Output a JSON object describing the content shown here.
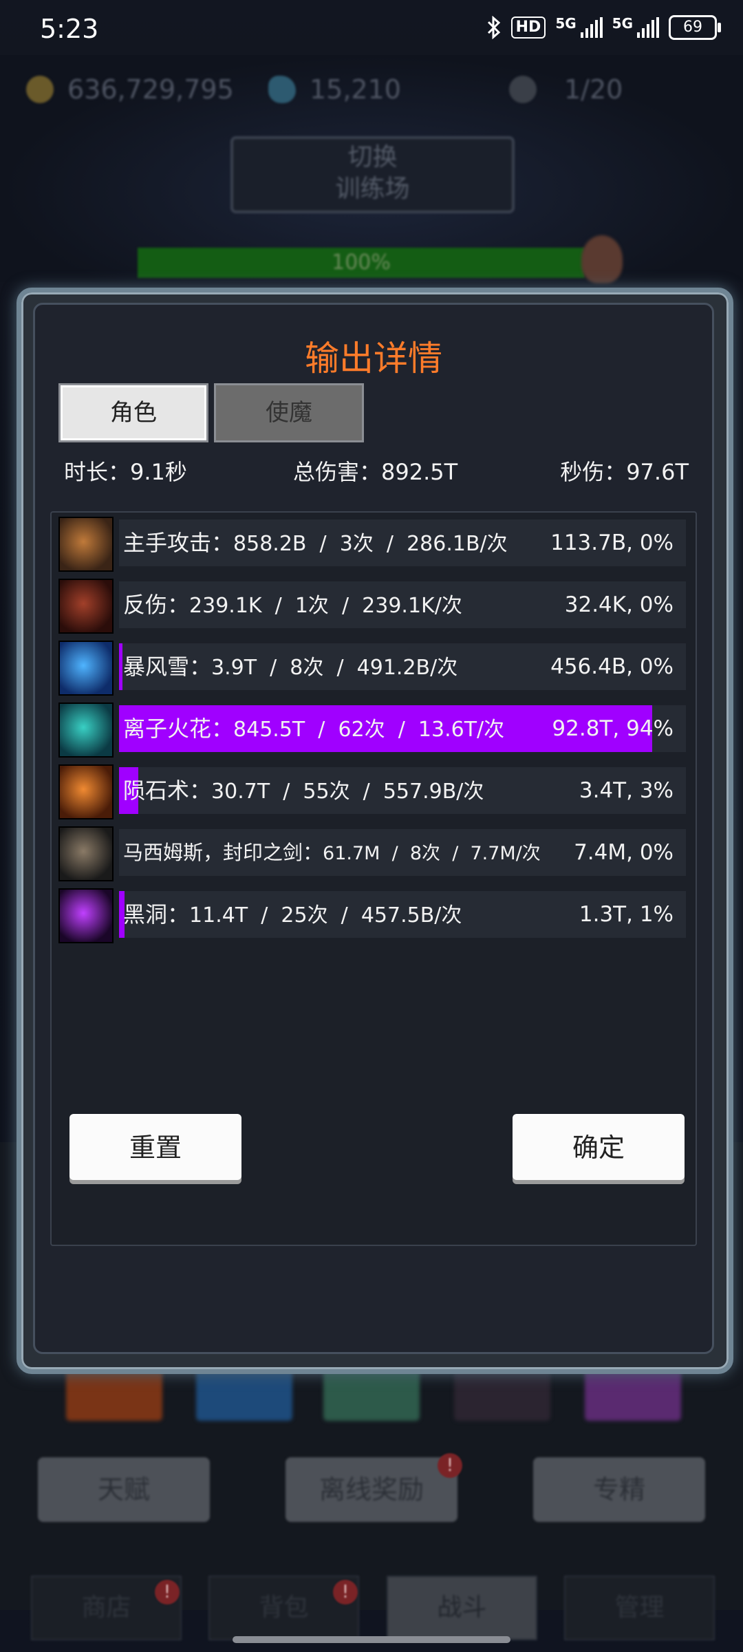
{
  "status_bar": {
    "time": "5:23",
    "network_badge": "HD",
    "network_type_1": "5G",
    "network_type_2": "5G",
    "battery": "69"
  },
  "background": {
    "gold": "636,729,795",
    "gems": "15,210",
    "keys": "1/20",
    "switch_button": "切换\n训练场",
    "hp_percent": "100%",
    "buttons": [
      "天赋",
      "离线奖励",
      "专精"
    ],
    "bottom_tabs": [
      "商店",
      "背包",
      "战斗",
      "管理"
    ],
    "badge": "!"
  },
  "dialog": {
    "title": "输出详情",
    "tabs": [
      "角色",
      "使魔"
    ],
    "duration": "时长：9.1秒",
    "total_damage": "总伤害：892.5T",
    "dps": "秒伤：97.6T",
    "rows": [
      {
        "name": "主手攻击：",
        "detail": "858.2B  /  3次  /  286.1B/次",
        "value": "113.7B, 0%",
        "share": 0.0,
        "icon": "sword-slash-icon",
        "colors": [
          "#c07a3a",
          "#3a2416"
        ]
      },
      {
        "name": "反伤：",
        "detail": "239.1K  /  1次  /  239.1K/次",
        "value": "32.4K, 0%",
        "share": 0.0,
        "icon": "thorns-icon",
        "colors": [
          "#a2402a",
          "#2b0d0a"
        ]
      },
      {
        "name": "暴风雪：",
        "detail": "3.9T  /  8次  /  491.2B/次",
        "value": "456.4B, 0%",
        "share": 0.005,
        "icon": "blizzard-icon",
        "colors": [
          "#4fb4ff",
          "#0e2c6a"
        ]
      },
      {
        "name": "离子火花：",
        "detail": "845.5T  /  62次  /  13.6T/次",
        "value": "92.8T, 94%",
        "share": 0.94,
        "icon": "ion-spark-icon",
        "colors": [
          "#39d0c4",
          "#0b3a44"
        ]
      },
      {
        "name": "陨石术：",
        "detail": "30.7T  /  55次  /  557.9B/次",
        "value": "3.4T, 3%",
        "share": 0.03,
        "icon": "meteor-icon",
        "colors": [
          "#f08a32",
          "#4a1c08"
        ]
      },
      {
        "name": "马西姆斯，封印之剑：",
        "detail": "61.7M  /  8次  /  7.7M/次",
        "value": "7.4M, 0%",
        "share": 0.0,
        "icon": "sealed-sword-icon",
        "colors": [
          "#8a7a66",
          "#1a1a1a"
        ]
      },
      {
        "name": "黑洞：",
        "detail": "11.4T  /  25次  /  457.5B/次",
        "value": "1.3T, 1%",
        "share": 0.01,
        "icon": "black-hole-icon",
        "colors": [
          "#c040ff",
          "#1a0628"
        ]
      }
    ],
    "reset_button": "重置",
    "confirm_button": "确定"
  },
  "colors": {
    "accent": "#ff7c2a",
    "bar_fill": "#a000ff"
  }
}
